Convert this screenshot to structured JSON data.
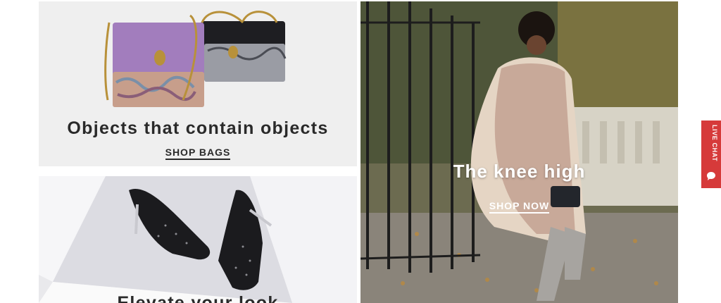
{
  "tiles": {
    "bags": {
      "title": "Objects that contain objects",
      "cta": "SHOP BAGS"
    },
    "shoes": {
      "title": "Elevate your look"
    },
    "boots": {
      "title": "The knee high",
      "cta": "SHOP NOW"
    }
  },
  "live_chat": {
    "label": "LIVE CHAT",
    "icon": "chat-bubble-icon",
    "color": "#d63a3a"
  }
}
